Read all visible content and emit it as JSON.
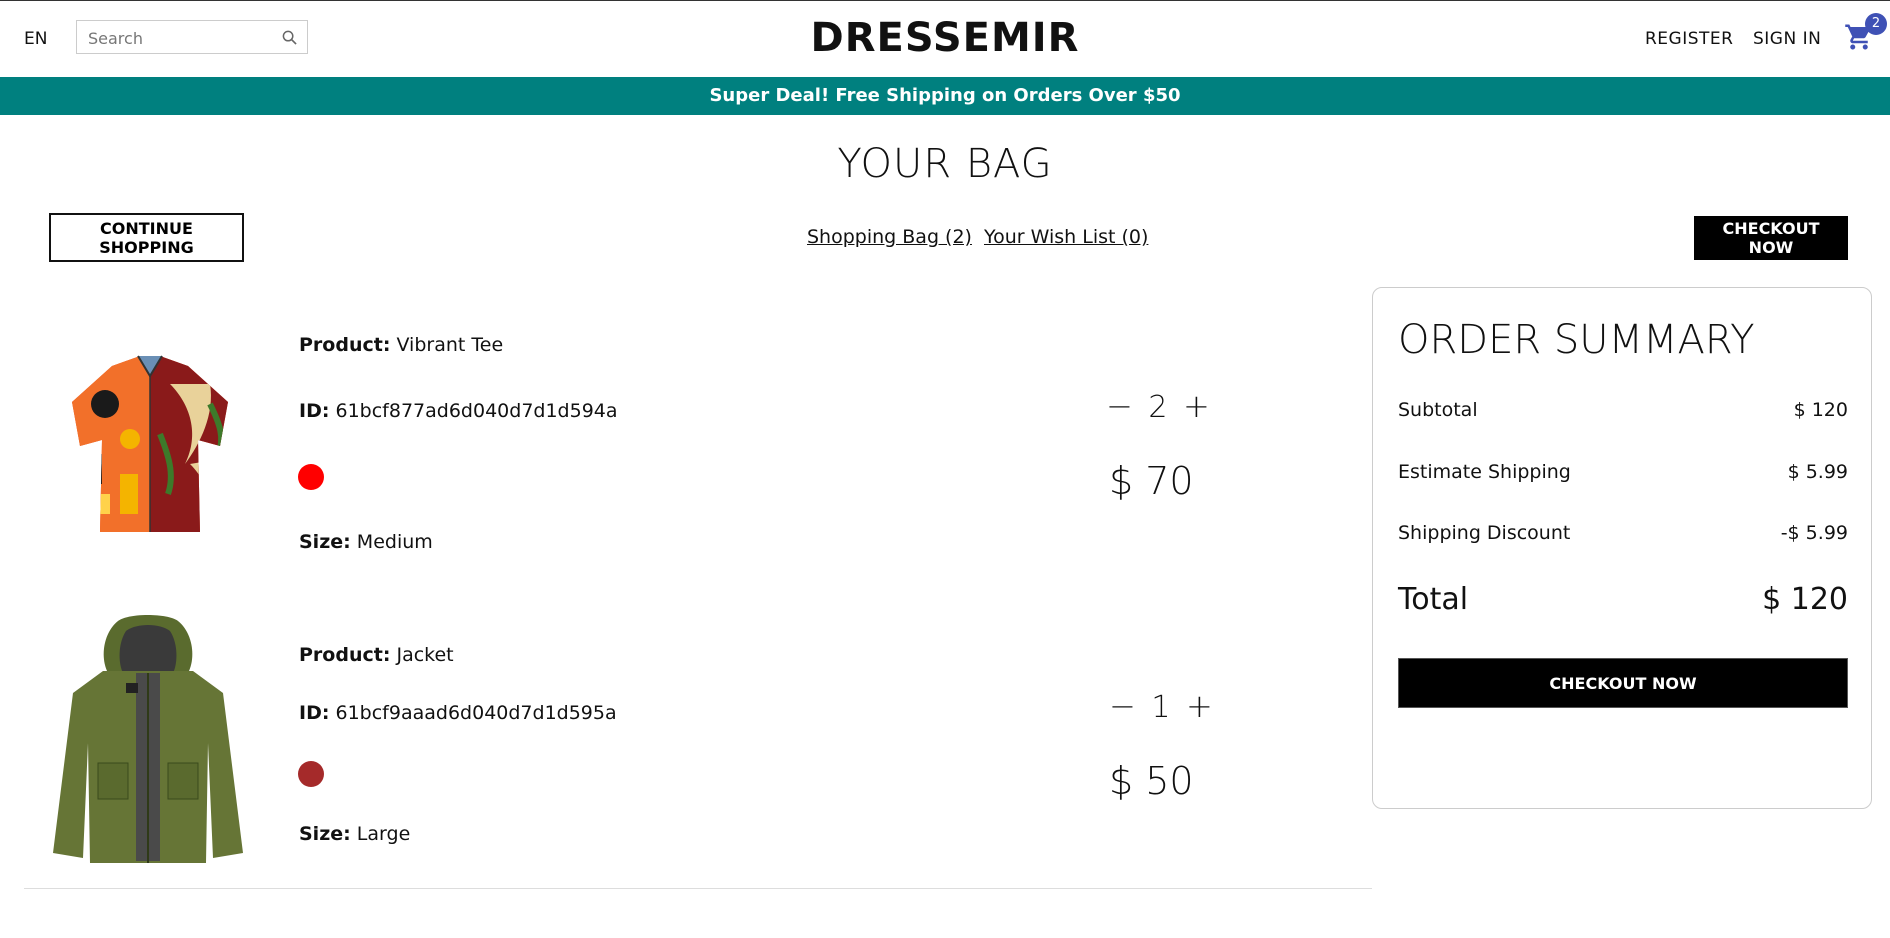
{
  "header": {
    "language": "EN",
    "search_placeholder": "Search",
    "logo": "DRESSEMIR",
    "register": "REGISTER",
    "sign_in": "SIGN IN",
    "cart_count": "2"
  },
  "banner": "Super Deal! Free Shipping on Orders Over $50",
  "page": {
    "title": "YOUR BAG",
    "continue_shopping": "CONTINUE SHOPPING",
    "shopping_bag_link": "Shopping Bag (2)",
    "wish_list_link": "Your Wish List (0)",
    "checkout_top": "CHECKOUT NOW"
  },
  "labels": {
    "product": "Product:",
    "id": "ID:",
    "size": "Size:",
    "minus": "−",
    "plus": "+"
  },
  "products": [
    {
      "name": "Vibrant Tee",
      "id": "61bcf877ad6d040d7d1d594a",
      "color": "#ff0000",
      "size": "Medium",
      "quantity": "2",
      "price": "$ 70",
      "icon": "shirt-image"
    },
    {
      "name": "Jacket",
      "id": "61bcf9aaad6d040d7d1d595a",
      "color": "#a52a2a",
      "size": "Large",
      "quantity": "1",
      "price": "$ 50",
      "icon": "jacket-image"
    }
  ],
  "summary": {
    "title": "ORDER SUMMARY",
    "subtotal_label": "Subtotal",
    "subtotal_value": "$ 120",
    "shipping_label": "Estimate Shipping",
    "shipping_value": "$ 5.99",
    "discount_label": "Shipping Discount",
    "discount_value": "-$ 5.99",
    "total_label": "Total",
    "total_value": "$ 120",
    "checkout": "CHECKOUT NOW"
  },
  "colors": {
    "banner": "#00807f",
    "badge": "#3f51b5",
    "cart_icon": "#3f51b5"
  }
}
